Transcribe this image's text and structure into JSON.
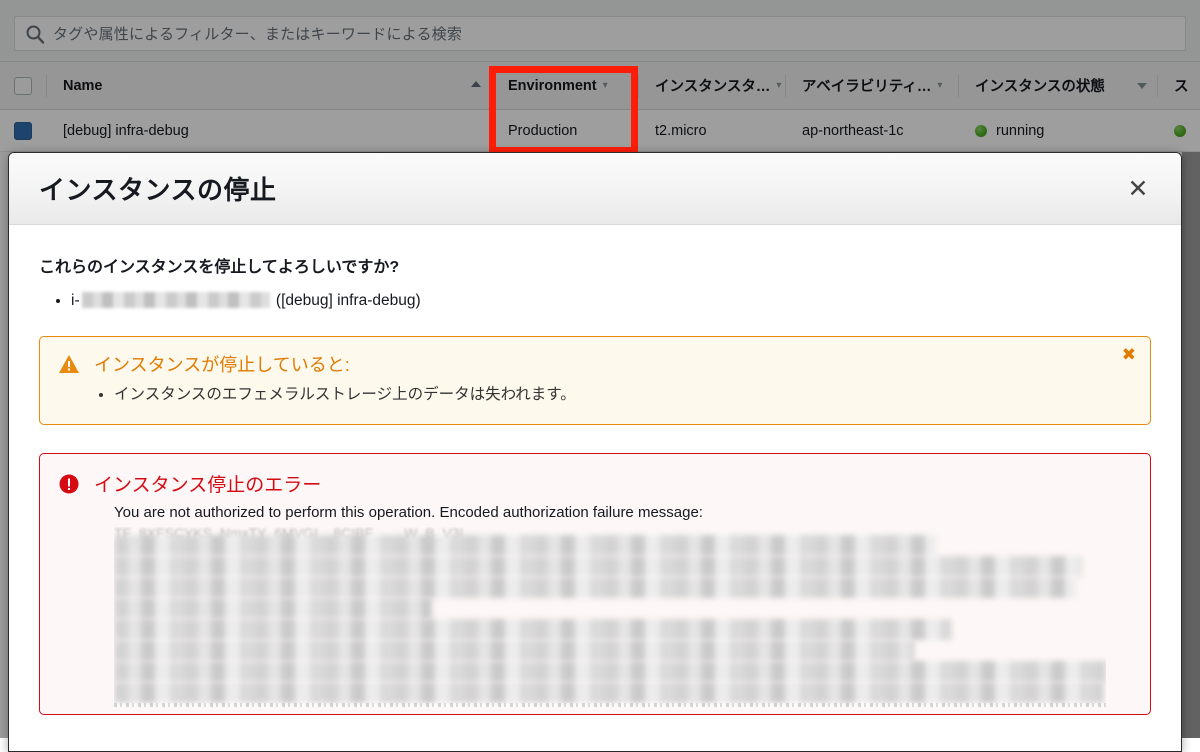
{
  "background_console": {
    "search": {
      "icon": "search-icon",
      "placeholder": "タグや属性によるフィルター、またはキーワードによる検索",
      "value": ""
    },
    "table": {
      "columns": [
        {
          "label": "Name",
          "has_caret": false,
          "sorted": "asc"
        },
        {
          "label": "Environment",
          "has_caret": true,
          "sorted": ""
        },
        {
          "label": "インスタンスタ…",
          "has_caret": true,
          "sorted": ""
        },
        {
          "label": "アベイラビリティ…",
          "has_caret": true,
          "sorted": ""
        },
        {
          "label": "インスタンスの状態",
          "has_caret": true,
          "sorted": ""
        },
        {
          "label": "ス",
          "has_caret": false,
          "sorted": ""
        }
      ],
      "rows": [
        {
          "selected": true,
          "name": "[debug] infra-debug",
          "environment": "Production",
          "instance_type": "t2.micro",
          "availability_zone": "ap-northeast-1c",
          "instance_state": "running",
          "state_color": "#4caf22"
        }
      ]
    }
  },
  "annotation": {
    "highlight_color": "#fd1d08",
    "highlight_target": "Environment"
  },
  "modal": {
    "title": "インスタンスの停止",
    "close_icon": "close-icon",
    "close_label": "✕",
    "confirm_question": "これらのインスタンスを停止してよろしいですか?",
    "instances": [
      {
        "id_prefix": "i-",
        "id_redacted": true,
        "name": "([debug] infra-debug)"
      }
    ],
    "warning_alert": {
      "icon": "warning-triangle-icon",
      "title": "インスタンスが停止していると:",
      "items": [
        "インスタンスのエフェメラルストレージ上のデータは失われます。"
      ],
      "dismiss_icon": "close-icon",
      "dismiss_label": "✖",
      "border_color": "#e88b10",
      "background_color": "#fdf9ed",
      "title_color": "#e07b00"
    },
    "error_alert": {
      "icon": "error-exclamation-icon",
      "title": "インスタンス停止のエラー",
      "message": "You are not authorized to perform this operation. Encoded authorization failure message:",
      "encoded_message_redacted": true,
      "border_color": "#d60a12",
      "background_color": "#fdf7f7",
      "title_color": "#d60a12"
    }
  }
}
